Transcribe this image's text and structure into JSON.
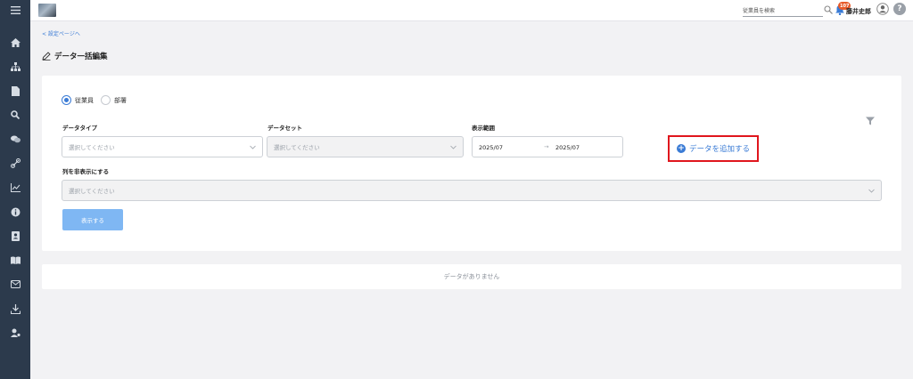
{
  "header": {
    "search_placeholder": "従業員を検索",
    "notification_count": "107",
    "user_name": "藤井史郎",
    "help_label": "?"
  },
  "breadcrumb": {
    "back_label": "< 設定ページへ"
  },
  "page": {
    "title": "データ一括編集"
  },
  "form": {
    "radios": [
      {
        "label": "従業員",
        "checked": true
      },
      {
        "label": "部署",
        "checked": false
      }
    ],
    "data_type": {
      "label": "データタイプ",
      "placeholder": "選択してください"
    },
    "data_set": {
      "label": "データセット",
      "placeholder": "選択してください"
    },
    "display_range": {
      "label": "表示範囲",
      "from": "2025/07",
      "arrow": "→",
      "to": "2025/07"
    },
    "hide_columns": {
      "label": "列を非表示にする",
      "placeholder": "選択してください"
    },
    "add_data_label": "データを追加する",
    "show_label": "表示する"
  },
  "results": {
    "empty_message": "データがありません"
  },
  "colors": {
    "accent": "#3a7bd5",
    "sidebar": "#2c3a4c",
    "highlight": "#e0161d",
    "badge": "#e85b2a"
  }
}
